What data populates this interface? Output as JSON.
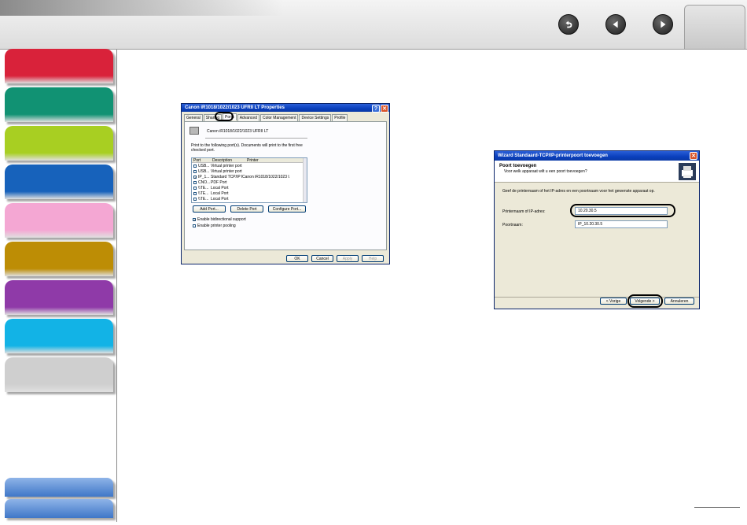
{
  "colors": {
    "sidebar_tabs": [
      "#d9223a",
      "#119273",
      "#a8cf22",
      "#1762bb",
      "#f4a7d3",
      "#bd8d05",
      "#8f3aa8",
      "#12b3e6",
      "#cfcfcf"
    ],
    "sidebar_bottom": "#4f86d4",
    "xp_titlebar": "#0a46c8",
    "highlight": "#000000"
  },
  "header": {
    "icons": [
      "back-return-icon",
      "previous-page-icon",
      "next-page-icon"
    ]
  },
  "properties_dialog": {
    "title": "Canon iR1018/1022/1023 UFRII LT Properties",
    "tabs": [
      "General",
      "Sharing",
      "Ports",
      "Advanced",
      "Color Management",
      "Device Settings",
      "Profile"
    ],
    "active_tab": "Ports",
    "printer_name": "Canon iR1018/1022/1023 UFRII LT",
    "instructions": "Print to the following port(s). Documents will print to the first free checked port.",
    "columns": [
      "Port",
      "Description",
      "Printer"
    ],
    "ports": [
      {
        "port": "USB...",
        "description": "Virtual printer port fo...",
        "printer": "",
        "checked": false
      },
      {
        "port": "USB...",
        "description": "Virtual printer port fo...",
        "printer": "",
        "checked": false
      },
      {
        "port": "IP_1...",
        "description": "Standard TCP/IP Port",
        "printer": "Canon iR1018/1022/1023 UFRII LT...",
        "checked": true
      },
      {
        "port": "CNO...",
        "description": "PDF Port",
        "printer": "",
        "checked": false
      },
      {
        "port": "\\\\TE...",
        "description": "Local Port",
        "printer": "",
        "checked": false
      },
      {
        "port": "\\\\TE...",
        "description": "Local Port",
        "printer": "",
        "checked": false
      },
      {
        "port": "\\\\TE...",
        "description": "Local Port",
        "printer": "",
        "checked": false
      }
    ],
    "buttons": {
      "add_port": "Add Port...",
      "delete_port": "Delete Port",
      "configure_port": "Configure Port...",
      "ok": "OK",
      "cancel": "Cancel",
      "apply": "Apply",
      "help": "Help"
    },
    "checkboxes": {
      "bidirectional": "Enable bidirectional support",
      "pooling": "Enable printer pooling"
    }
  },
  "wizard_dialog": {
    "title": "Wizard Standaard-TCP/IP-printerpoort toevoegen",
    "heading": "Poort toevoegen",
    "subheading": "Voor welk apparaat wilt u een poort toevoegen?",
    "instruction": "Geef de printernaam of het IP-adres en een poortnaam voor het gewenste apparaat op.",
    "printer_name_label": "Printernaam of IP-adres:",
    "printer_name_value": "10.20.30.5",
    "port_name_label": "Poortnaam:",
    "port_name_value": "IP_10.20.30.5",
    "buttons": {
      "back": "< Vorige",
      "next": "Volgende >",
      "cancel": "Annuleren"
    }
  }
}
